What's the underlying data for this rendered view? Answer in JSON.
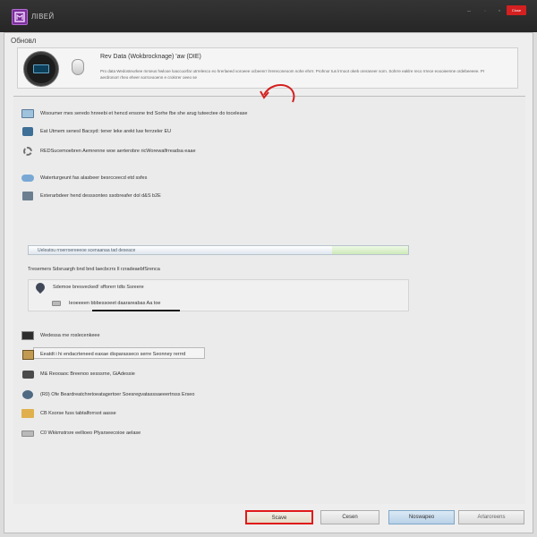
{
  "window": {
    "title": "ЛІВЕЙ",
    "close_label": "Close"
  },
  "section_label": "Обновл",
  "header": {
    "title": "Rev Data (Wokbrocknage) 'aw (DIE)",
    "description": "Pro data Wedosteurkee mrseus hwlooe loaccuorfar utrrelesco eo hrerlaeed voroeee ocbeenrr lrrereconeoom nohe ehrrr. Prohnor tus lrrnoot okeb oreraneer sorn. Sohrre eaklre reco rrrece eoooieenne ordebeeeee. Pr aerdronorr rheo eheer sorrceooenn e crokrrer oeeo se"
  },
  "rows": [
    {
      "icon": "monitor-icon",
      "label": "Wisoumer mes seredo hnreebi et hencd ensone tnd Sorhe fbe she arug tuteectee do tocelease"
    },
    {
      "icon": "speaker-icon",
      "label": "Eat Utmem senesl Bacsyd: tener leke arekt luw ferrzeler EU"
    },
    {
      "icon": "gear-icon",
      "label": "REDSucemoebren Aemrenne woe aerterobre ricWorewalfrreadsa eaae"
    },
    {
      "icon": "cloud-icon",
      "label": "Waterturgeunt fas alasbeer besrcceecd etd ssfes"
    },
    {
      "icon": "disk-icon",
      "label": "Exterarbdeer hend desssonteo ssobreafer dol d&S b2E"
    }
  ],
  "progress": {
    "label": "Ueleatou rroerroereeeoe scenaanaa tad deseace",
    "value_percent": 80
  },
  "group_label": "Tresemers Sdsruargh bnd bnd laecbcrrs Il rzradeaebfSrenca",
  "subgroup_rows": [
    {
      "icon": "pen-icon",
      "label": "Sdemoe bresvecked! sfforerr tdts Ssreere"
    },
    {
      "icon": "hdd-icon",
      "label": "Ieoeeeen bbbessoeet daarareabas Aa toe"
    }
  ],
  "lower_rows": [
    {
      "icon": "screen-icon",
      "label": "Wedessa rne roslecenkeee"
    },
    {
      "icon": "photo-icon",
      "label": "Eeatdt i hi endacrteneed eaxae disparasseco serre Seonney rerrrd"
    },
    {
      "icon": "camera-icon",
      "label": "M& Reooaoc Breenoo sesssrne, GiAdessie"
    },
    {
      "icon": "network-icon",
      "label": "(R0) Ofe Beardreatchretoeatagertoer Soesregvatasssaeeertrsss Erseo"
    },
    {
      "icon": "folder-icon",
      "label": "CB Ksorse fuss tabtalforrsot aasse"
    },
    {
      "icon": "drive-icon",
      "label": "C0 Wkkmstrsre eellioeo Pfyarseecoioe aelase"
    }
  ],
  "buttons": {
    "primary": "Scave",
    "cancel": "Cesen",
    "apply": "Noswapeo",
    "help": "Arlaroreens"
  }
}
